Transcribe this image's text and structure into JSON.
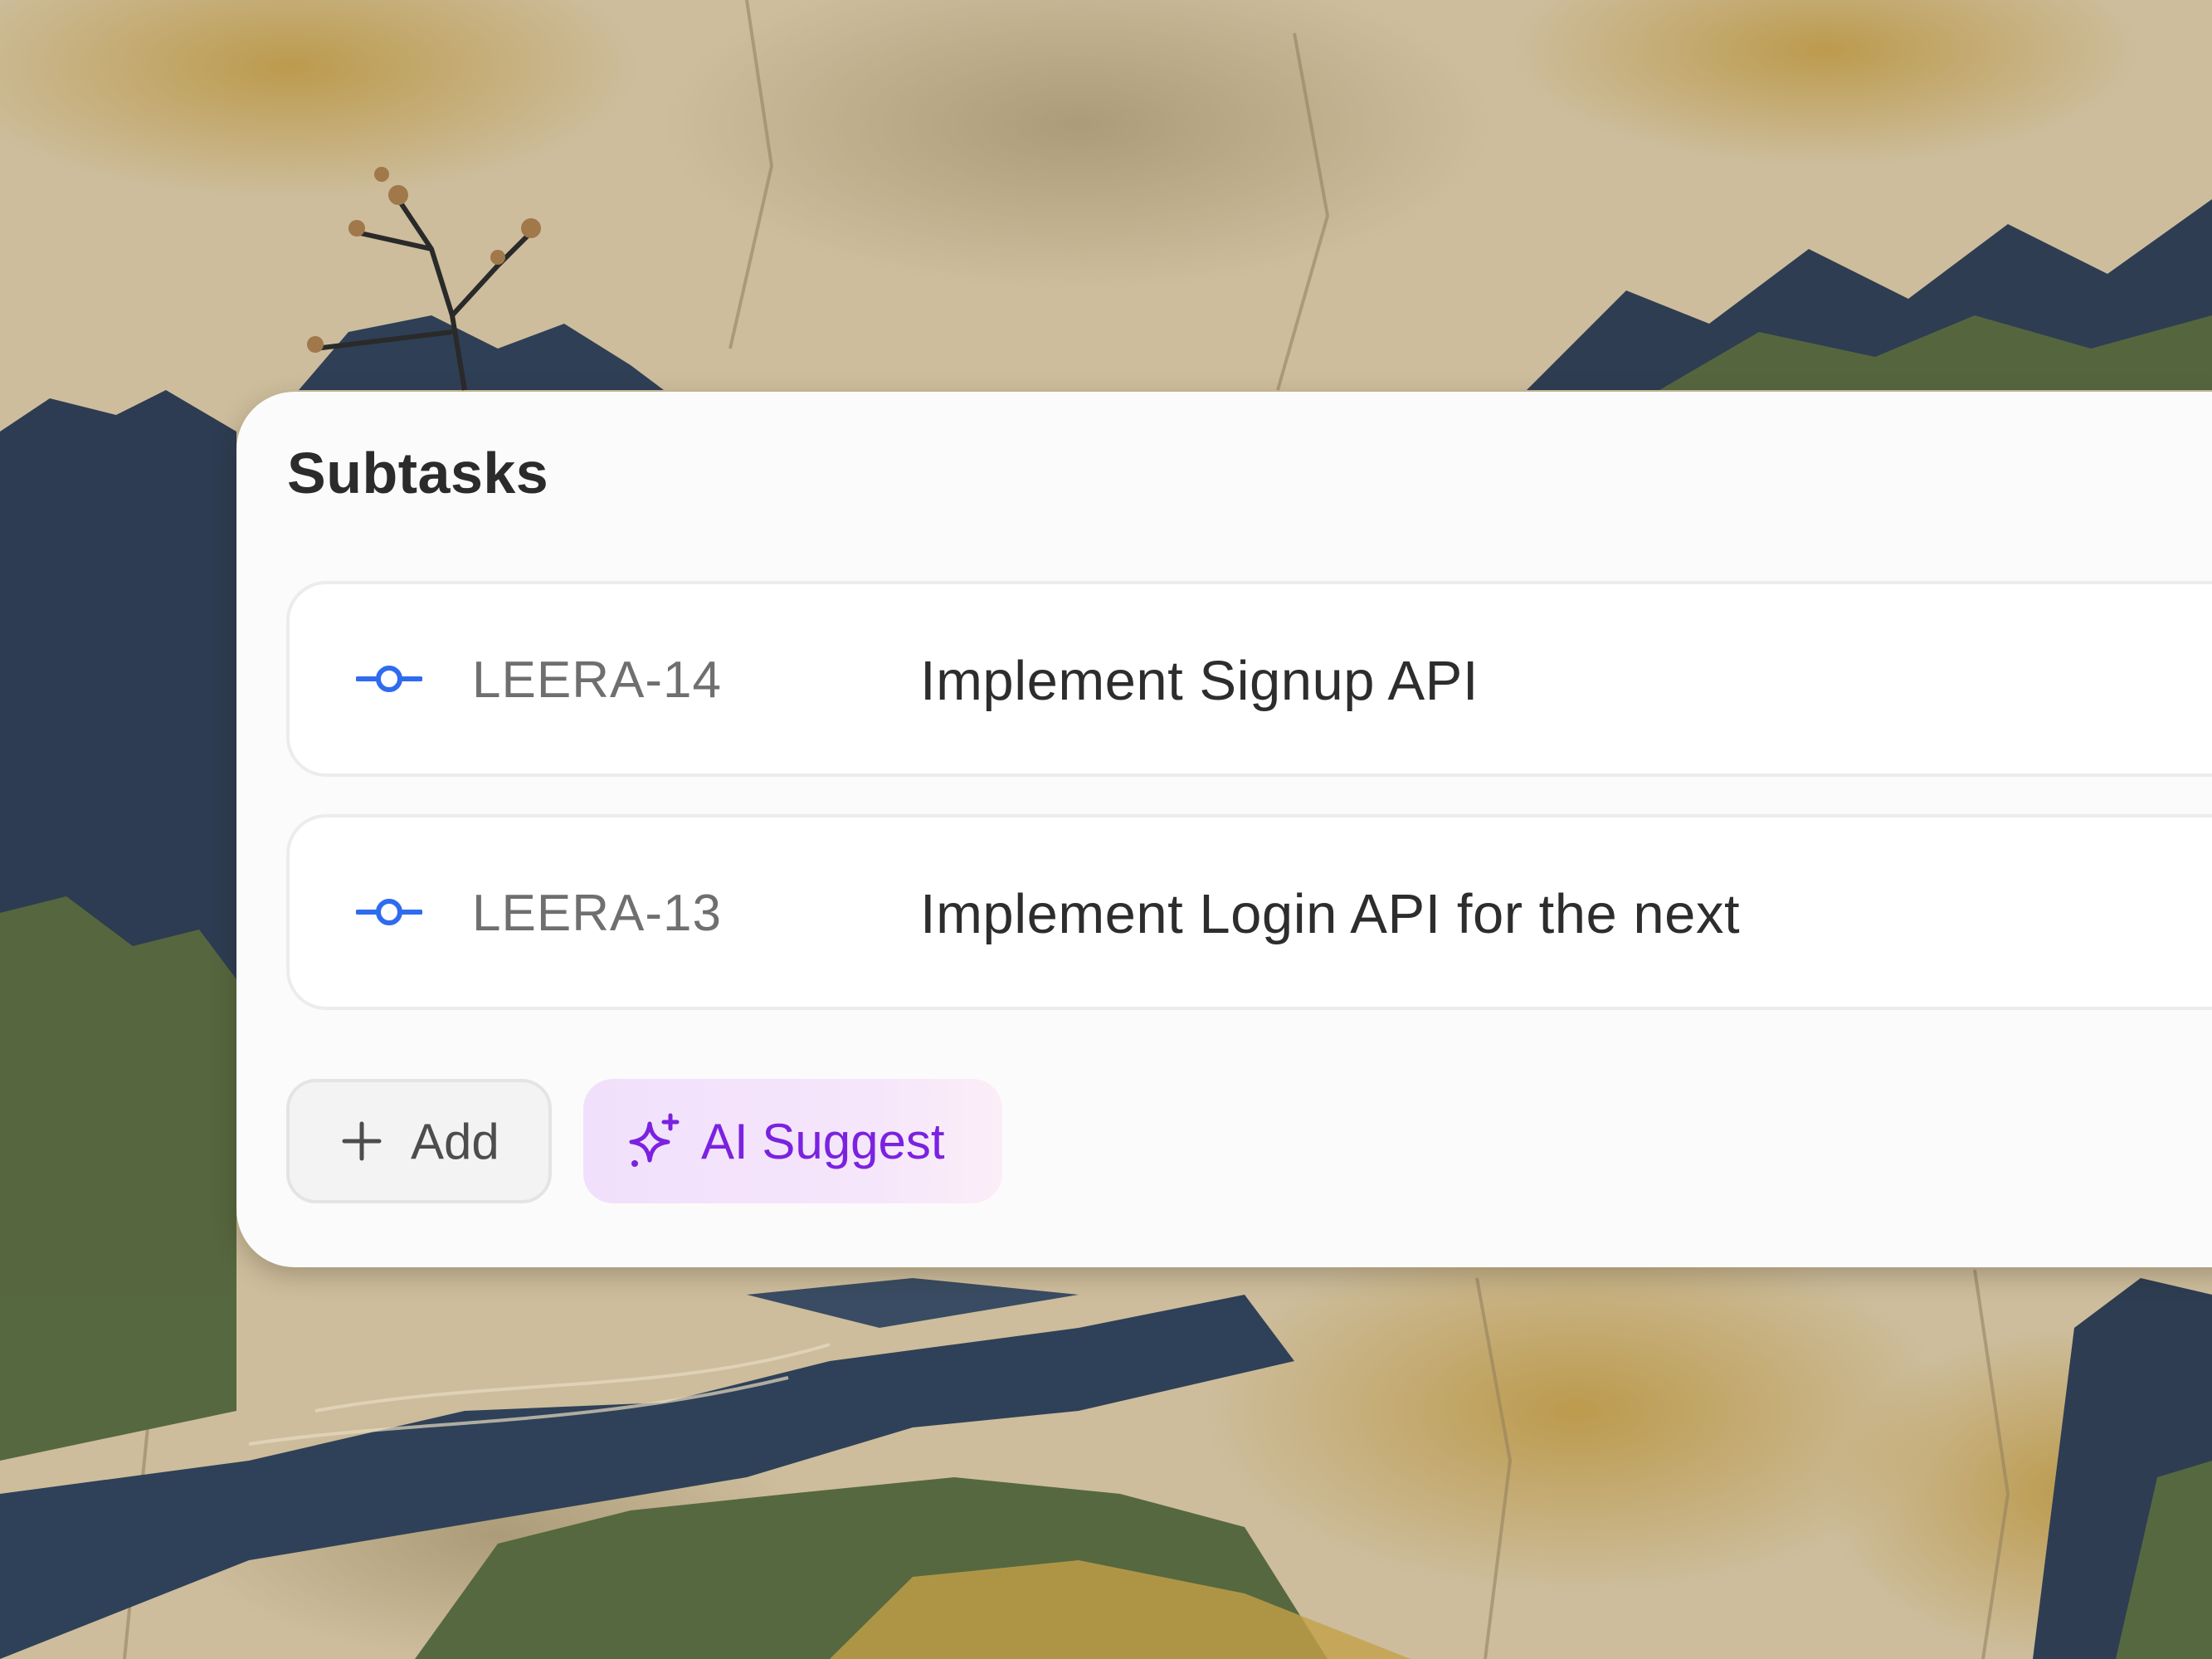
{
  "panel": {
    "title": "Subtasks"
  },
  "subtasks": [
    {
      "key": "LEERA-14",
      "name": "Implement Signup API",
      "icon": "commit-dot-icon"
    },
    {
      "key": "LEERA-13",
      "name": "Implement Login API for the next",
      "icon": "commit-dot-icon"
    }
  ],
  "actions": {
    "add_label": "Add",
    "add_icon": "plus-icon",
    "ai_label": "AI Suggest",
    "ai_icon": "sparkle-icon"
  },
  "colors": {
    "accent_blue": "#2f6bf0",
    "ai_purple": "#7a22e0",
    "ai_bg": "#f1e0fb",
    "card_bg": "#fbfbfb"
  }
}
